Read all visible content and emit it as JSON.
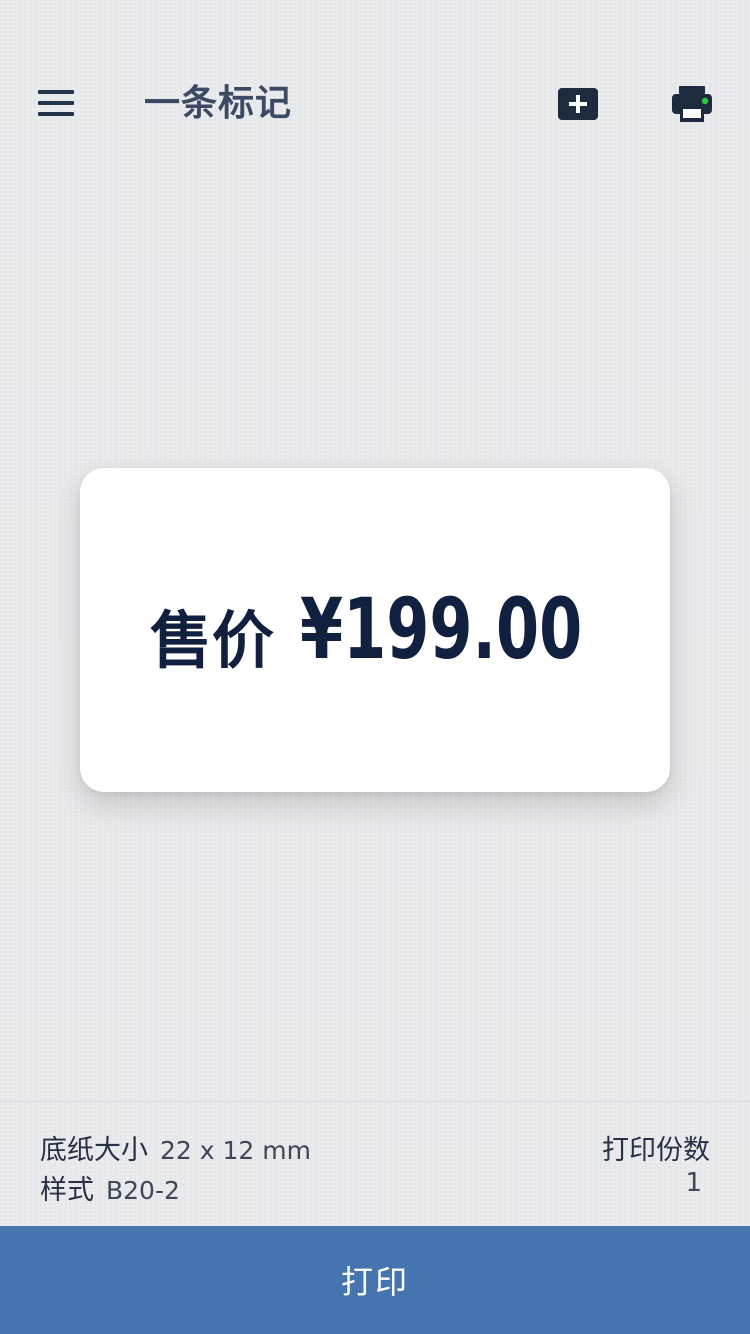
{
  "header": {
    "title": "一条标记",
    "menu_icon": "hamburger-menu-icon",
    "add_icon": "add-label-icon",
    "printer_icon": "printer-icon",
    "printer_status_color": "#27c93f"
  },
  "label": {
    "prefix": "售价",
    "price": "¥199.00",
    "text_color": "#12203f"
  },
  "settings": {
    "paper_size_label": "底纸大小",
    "paper_size_value": "22 x 12 mm",
    "style_label": "样式",
    "style_value": "B20-2",
    "copies_label": "打印份数",
    "copies_value": "1"
  },
  "actions": {
    "print_label": "打印",
    "print_bar_color": "#4574ae"
  }
}
